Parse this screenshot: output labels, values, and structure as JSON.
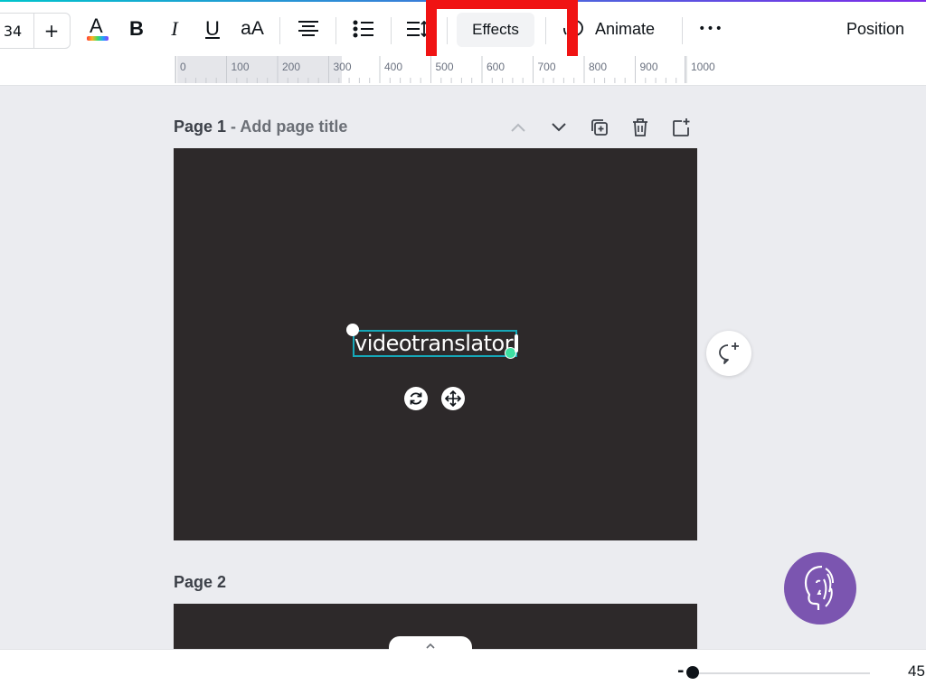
{
  "toolbar": {
    "font_size": "34",
    "plus_label": "+",
    "text_color_glyph": "A",
    "bold_glyph": "B",
    "italic_glyph": "I",
    "underline_glyph": "U",
    "case_glyph": "aA",
    "effects_label": "Effects",
    "animate_label": "Animate",
    "more_glyph": "•••",
    "position_label": "Position"
  },
  "ruler": {
    "ticks": [
      "0",
      "100",
      "200",
      "300",
      "400",
      "500",
      "600",
      "700",
      "800",
      "900",
      "1000"
    ]
  },
  "pages": [
    {
      "number_label": "Page 1",
      "title_placeholder": " - Add page title"
    },
    {
      "number_label": "Page 2"
    }
  ],
  "canvas": {
    "text_content": "videotranslator",
    "background_color": "#2d292a",
    "selection_color": "#16a7b8"
  },
  "zoom": {
    "minus_label": "-",
    "value": "45"
  },
  "colors": {
    "highlight": "#f01313",
    "assistant": "#7b55b0"
  }
}
